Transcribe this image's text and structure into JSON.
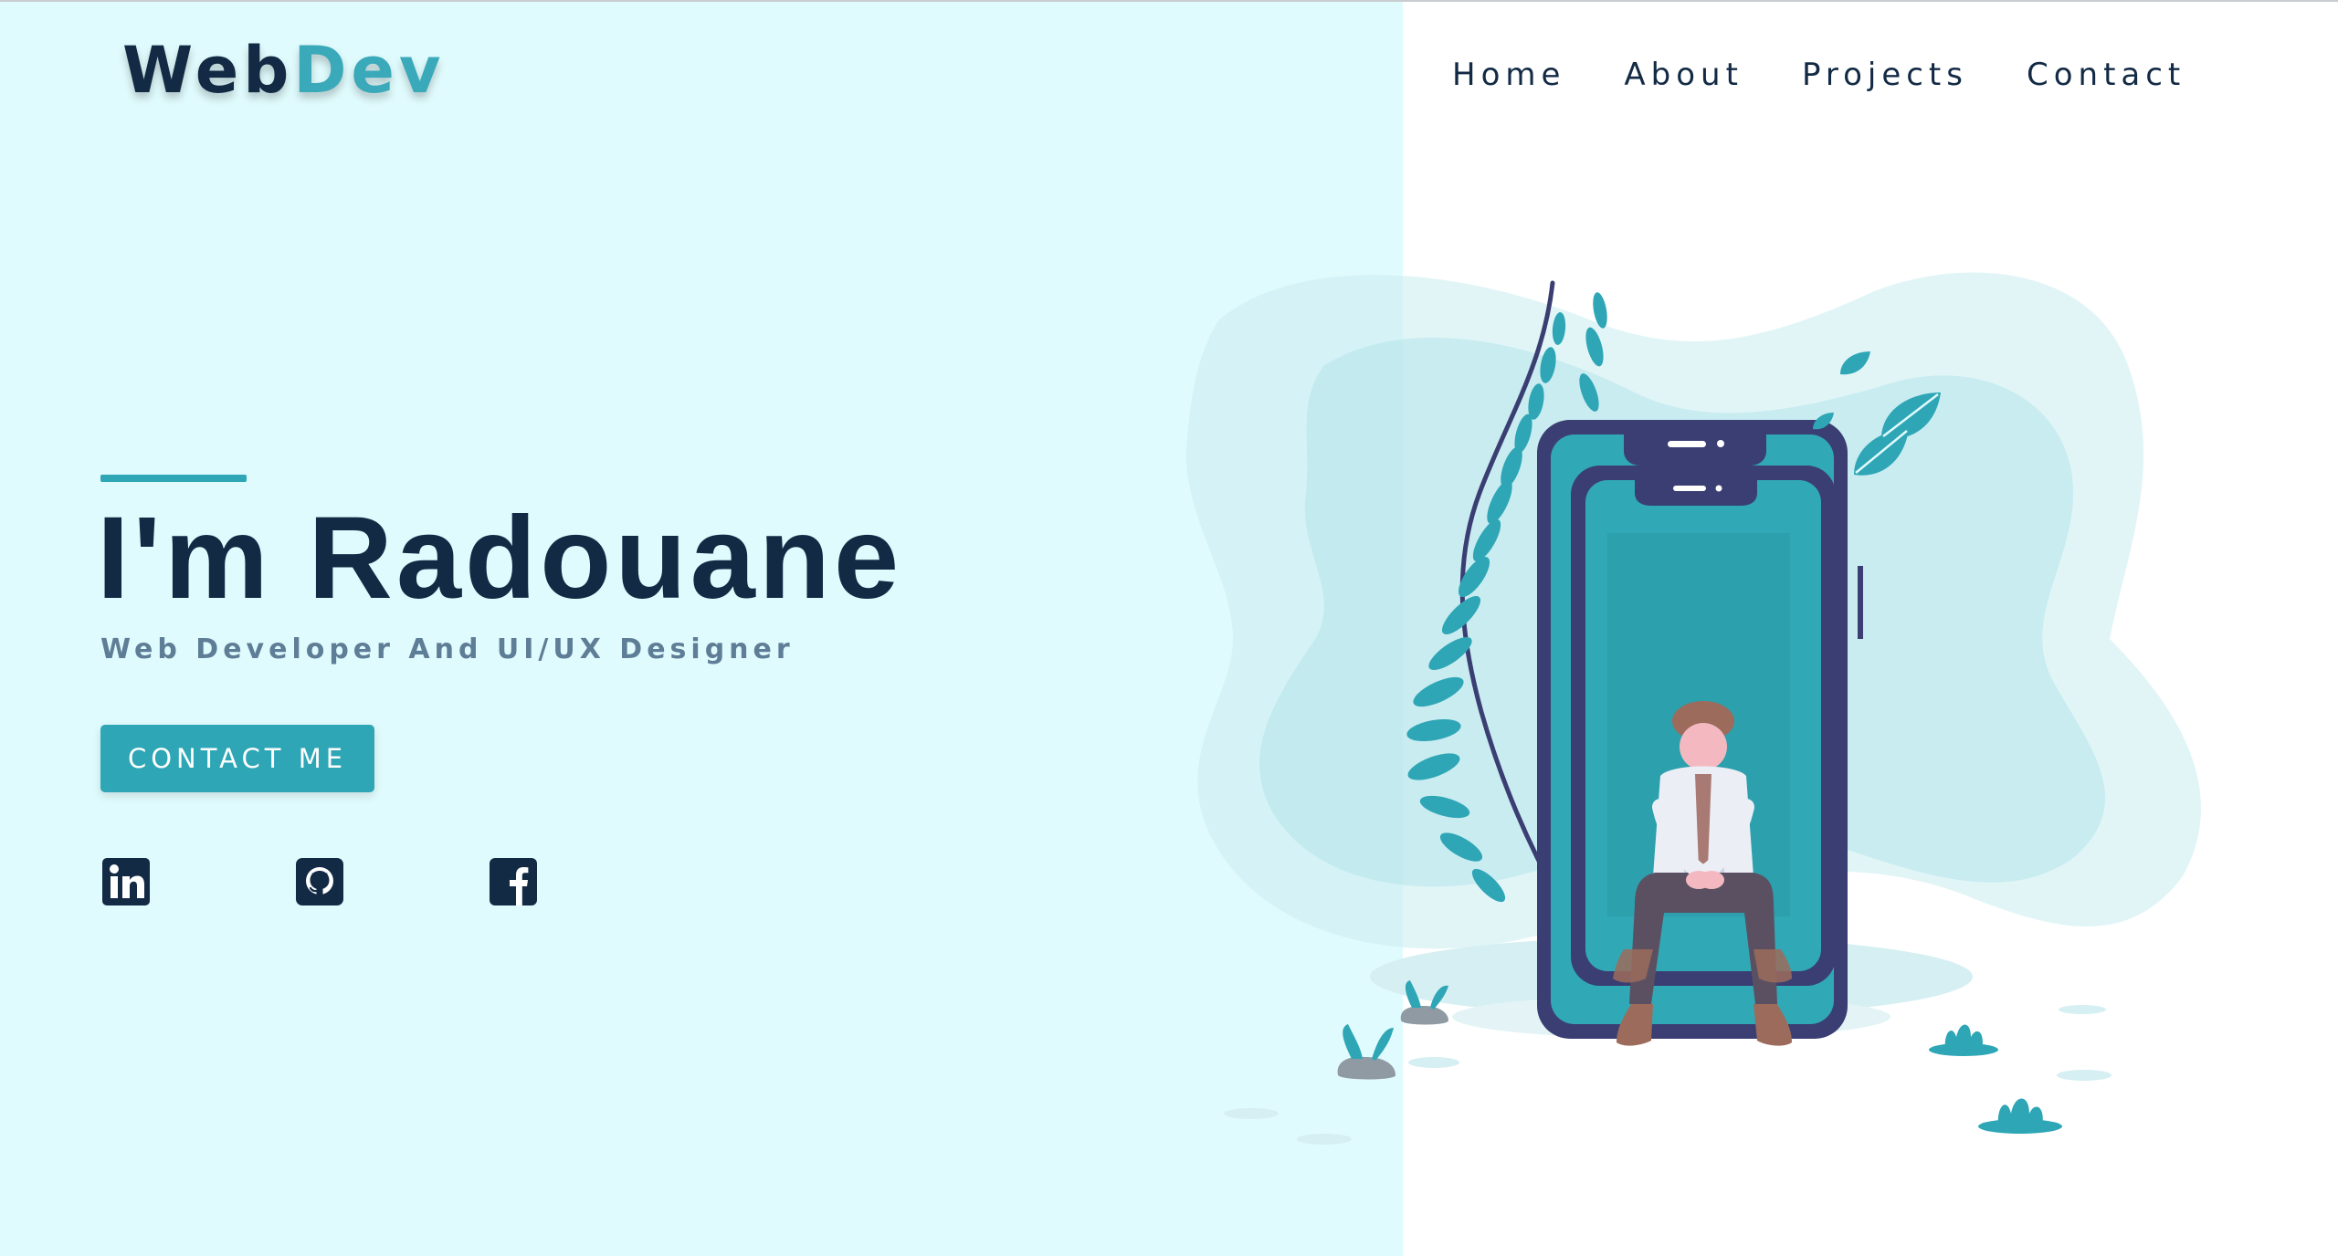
{
  "brand": {
    "part1": "Web",
    "part2": "Dev"
  },
  "nav": {
    "items": [
      {
        "label": "Home"
      },
      {
        "label": "About"
      },
      {
        "label": "Projects"
      },
      {
        "label": "Contact"
      }
    ]
  },
  "hero": {
    "title": "I'm Radouane",
    "subtitle": "Web Developer And UI/UX Designer",
    "cta_label": "CONTACT ME"
  },
  "social": [
    {
      "icon": "linkedin-icon"
    },
    {
      "icon": "github-icon"
    },
    {
      "icon": "facebook-icon"
    }
  ],
  "colors": {
    "left_background": "#e0fbfd",
    "primary_dark": "#132a45",
    "accent": "#2ea6b6",
    "subtitle": "#5e7d96",
    "phone_frame": "#3a3e72",
    "phone_screen": "#31a8b5"
  }
}
